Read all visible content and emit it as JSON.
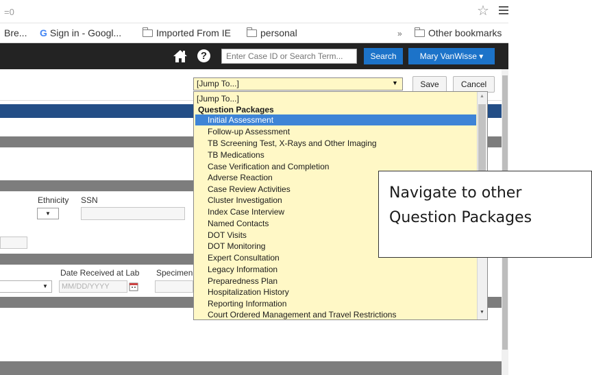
{
  "browser": {
    "address_text": "=0",
    "bookmarks": [
      {
        "label": "Bre...",
        "type": "plain"
      },
      {
        "label": "Sign in - Googl...",
        "type": "google"
      },
      {
        "label": "Imported From IE",
        "type": "folder"
      },
      {
        "label": "personal",
        "type": "folder"
      },
      {
        "label": "»",
        "type": "chevron"
      },
      {
        "label": "Other bookmarks",
        "type": "folder"
      }
    ]
  },
  "header": {
    "search_placeholder": "Enter Case ID or Search Term...",
    "search_button": "Search",
    "user_name": "Mary VanWisse ▾"
  },
  "toolbar": {
    "jump_selected": "[Jump To...]",
    "save_label": "Save",
    "cancel_label": "Cancel"
  },
  "form": {
    "ethnicity_label": "Ethnicity",
    "ssn_label": "SSN",
    "date_received_label": "Date Received at Lab",
    "specimen_label": "Specimen",
    "date_placeholder": "MM/DD/YYYY"
  },
  "dropdown": {
    "items": [
      {
        "label": "[Jump To...]",
        "kind": "option"
      },
      {
        "label": "Question Packages",
        "kind": "group"
      },
      {
        "label": "Initial Assessment",
        "kind": "selected"
      },
      {
        "label": "Follow-up Assessment",
        "kind": "item"
      },
      {
        "label": "TB Screening Test, X-Rays and Other Imaging",
        "kind": "item"
      },
      {
        "label": "TB Medications",
        "kind": "item"
      },
      {
        "label": "Case Verification and Completion",
        "kind": "item"
      },
      {
        "label": "Adverse Reaction",
        "kind": "item"
      },
      {
        "label": "Case Review Activities",
        "kind": "item"
      },
      {
        "label": "Cluster Investigation",
        "kind": "item"
      },
      {
        "label": "Index Case Interview",
        "kind": "item"
      },
      {
        "label": "Named Contacts",
        "kind": "item"
      },
      {
        "label": "DOT Visits",
        "kind": "item"
      },
      {
        "label": "DOT Monitoring",
        "kind": "item"
      },
      {
        "label": "Expert Consultation",
        "kind": "item"
      },
      {
        "label": "Legacy Information",
        "kind": "item"
      },
      {
        "label": "Preparedness Plan",
        "kind": "item"
      },
      {
        "label": "Hospitalization History",
        "kind": "item"
      },
      {
        "label": "Reporting Information",
        "kind": "item"
      },
      {
        "label": "Court Ordered Management and Travel Restrictions",
        "kind": "item"
      }
    ]
  },
  "callout": {
    "line1": "Navigate to other",
    "line2": "Question Packages"
  },
  "icons": {
    "home": "home-icon",
    "help": "help-icon",
    "star": "bookmark-star-icon",
    "menu": "browser-menu-icon",
    "folder": "folder-icon",
    "calendar": "calendar-icon"
  },
  "colors": {
    "header_bg": "#232323",
    "accent_blue": "#1c73c9",
    "section_blue": "#234e86",
    "dropdown_bg": "#fff8c6",
    "highlight": "#3e84d6"
  }
}
